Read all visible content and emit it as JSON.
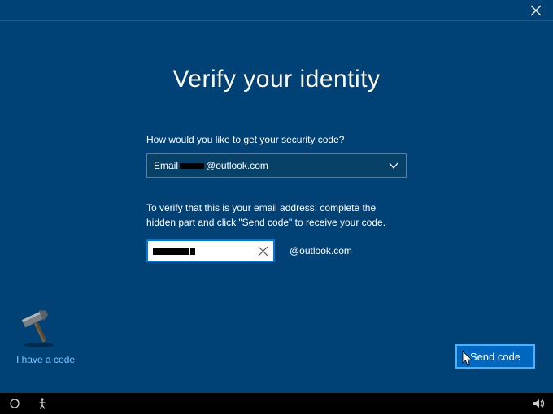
{
  "title": "Verify your identity",
  "prompt_label": "How would you like to get your security code?",
  "select_prefix": "Email ",
  "select_suffix": "@outlook.com",
  "verify_instruction": "To verify that this is your email address, complete the hidden part and click \"Send code\" to receive your code.",
  "email_domain_suffix": "@outlook.com",
  "have_code_link": "I have a code",
  "send_button": "Send code"
}
